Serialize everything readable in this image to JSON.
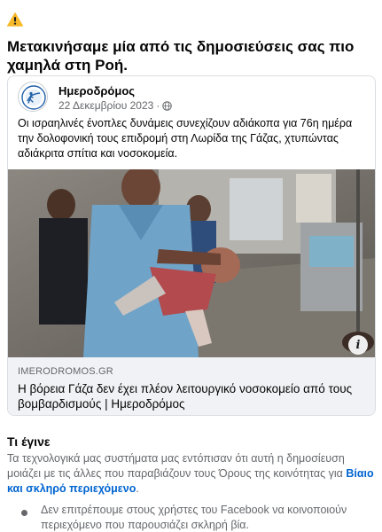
{
  "warning_icon": "warning-triangle-icon",
  "headline": "Μετακινήσαμε μία από τις δημοσιεύσεις σας πιο χαμηλά στη Ροή.",
  "post": {
    "author": "Ημεροδρόμος",
    "date": "22 Δεκεμβρίου 2023",
    "separator": "·",
    "audience_icon": "globe-icon",
    "text": "Οι ισραηλινές ένοπλες δυνάμεις συνεχίζουν αδιάκοπα για 76η ημέρα την δολοφονική τους επιδρομή στη Λωρίδα της Γάζας, χτυπώντας αδιάκριτα σπίτια και νοσοκομεία.",
    "link": {
      "domain": "IMERODROMOS.GR",
      "title": "Η βόρεια Γάζα δεν έχει πλέον λειτουργικό νοσοκομείο από τους βομβαρδισμούς | Ημεροδρόμος",
      "info_label": "i"
    }
  },
  "explanation": {
    "heading": "Τι έγινε",
    "text_before": "Τα τεχνολογικά μας συστήματα μας εντόπισαν ότι αυτή η δημοσίευση μοιάζει με τις άλλες που παραβιάζουν τους Όρους της κοινότητας για ",
    "link_text": "Βίαιο και σκληρό περιεχόμενο",
    "text_after": ".",
    "bullet": "Δεν επιτρέπουμε στους χρήστες του Facebook να κοινοποιούν περιεχόμενο που παρουσιάζει σκληρή βία."
  },
  "colors": {
    "warning": "#f7b928",
    "link": "#0064d1",
    "secondary_text": "#65676b",
    "link_preview_bg": "#f0f2f5"
  }
}
